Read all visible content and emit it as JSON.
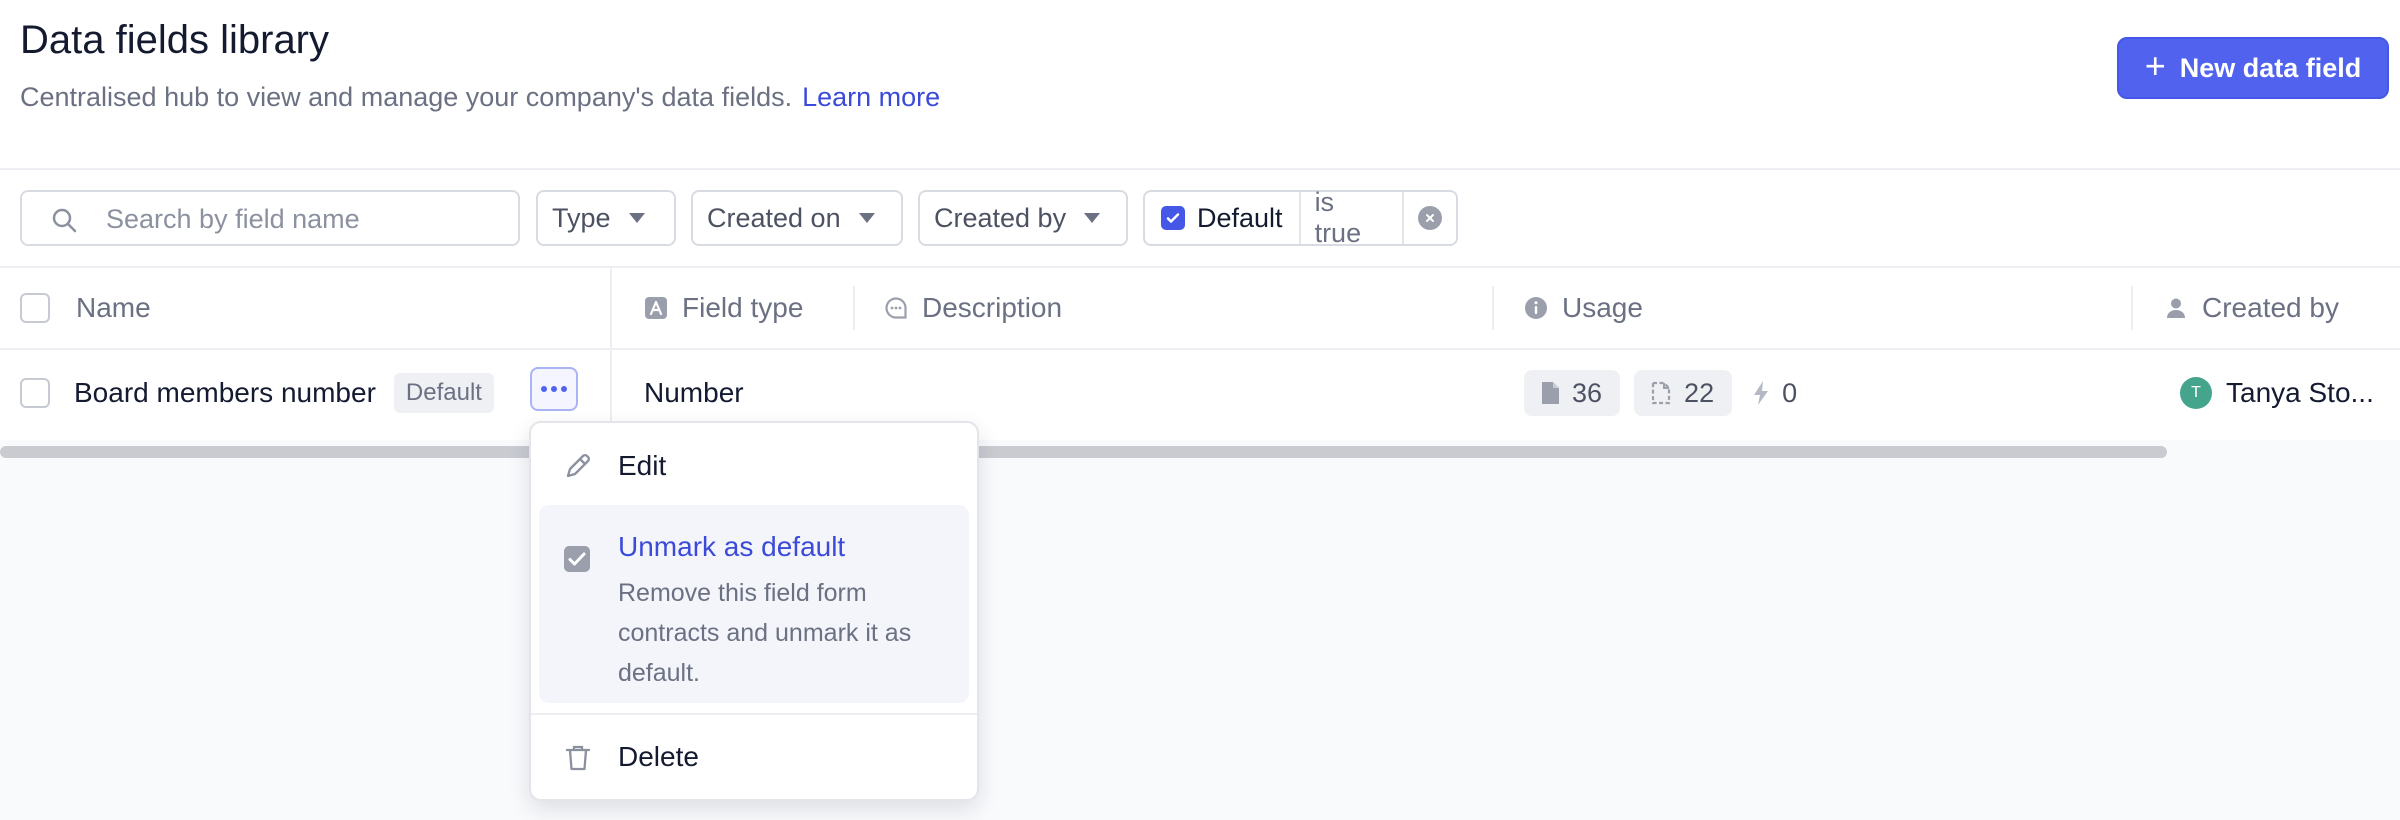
{
  "header": {
    "title": "Data fields library",
    "subtitle": "Centralised hub to view and manage your company's data fields.",
    "learn_more": "Learn more",
    "new_button": "New data field"
  },
  "toolbar": {
    "search_placeholder": "Search by field name",
    "filters": [
      "Type",
      "Created on",
      "Created by"
    ],
    "active_filter": {
      "field": "Default",
      "operator": "is true"
    }
  },
  "table": {
    "columns": {
      "name": "Name",
      "field_type": "Field type",
      "description": "Description",
      "usage": "Usage",
      "created_by": "Created by"
    },
    "rows": [
      {
        "name": "Board members number",
        "badge": "Default",
        "field_type": "Number",
        "description": "",
        "usage": {
          "documents": "36",
          "templates": "22",
          "automations": "0"
        },
        "created_by": {
          "initial": "T",
          "name": "Tanya Sto..."
        }
      }
    ]
  },
  "row_menu": {
    "edit": "Edit",
    "unmark": "Unmark as default",
    "unmark_desc": "Remove this field form contracts and unmark it as default.",
    "delete": "Delete"
  },
  "colors": {
    "accent": "#5163ee",
    "link": "#3b4bd8",
    "avatar": "#44a58c"
  }
}
